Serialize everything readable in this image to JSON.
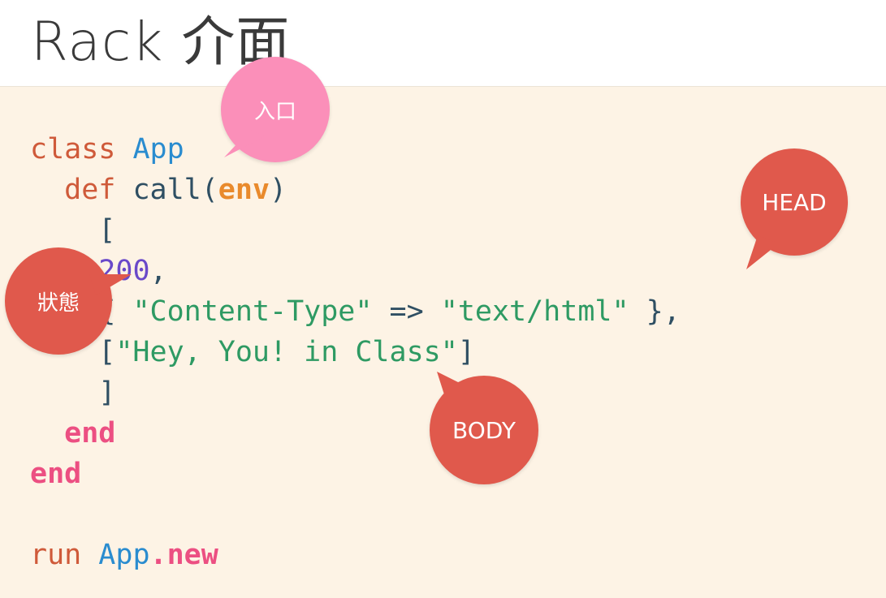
{
  "slide": {
    "title": "Rack 介面"
  },
  "code": {
    "lines": [
      [
        {
          "t": "class ",
          "c": "kw"
        },
        {
          "t": "App",
          "c": "cls"
        }
      ],
      [
        {
          "t": "  def ",
          "c": "kw"
        },
        {
          "t": "call(",
          "c": "plain"
        },
        {
          "t": "env",
          "c": "arg"
        },
        {
          "t": ")",
          "c": "plain"
        }
      ],
      [
        {
          "t": "    [",
          "c": "plain"
        }
      ],
      [
        {
          "t": "    ",
          "c": "plain"
        },
        {
          "t": "200",
          "c": "num"
        },
        {
          "t": ",",
          "c": "plain"
        }
      ],
      [
        {
          "t": "    { ",
          "c": "plain"
        },
        {
          "t": "\"Content-Type\"",
          "c": "str"
        },
        {
          "t": " => ",
          "c": "plain"
        },
        {
          "t": "\"text/html\"",
          "c": "str"
        },
        {
          "t": " },",
          "c": "plain"
        }
      ],
      [
        {
          "t": "    [",
          "c": "plain"
        },
        {
          "t": "\"Hey, You! in Class\"",
          "c": "str"
        },
        {
          "t": "]",
          "c": "plain"
        }
      ],
      [
        {
          "t": "    ]",
          "c": "plain"
        }
      ],
      [
        {
          "t": "  end",
          "c": "end"
        }
      ],
      [
        {
          "t": "end",
          "c": "end"
        }
      ],
      [
        {
          "t": "",
          "c": "plain"
        }
      ],
      [
        {
          "t": "run ",
          "c": "kw"
        },
        {
          "t": "App",
          "c": "cls"
        },
        {
          "t": ".new",
          "c": "end"
        }
      ]
    ]
  },
  "callouts": {
    "entry": "入口",
    "head": "HEAD",
    "status": "狀態",
    "body": "BODY"
  },
  "colors": {
    "pink_bubble": "#fb8fb9",
    "red_bubble": "#e0594c",
    "panel_background": "#fdf3e5"
  }
}
